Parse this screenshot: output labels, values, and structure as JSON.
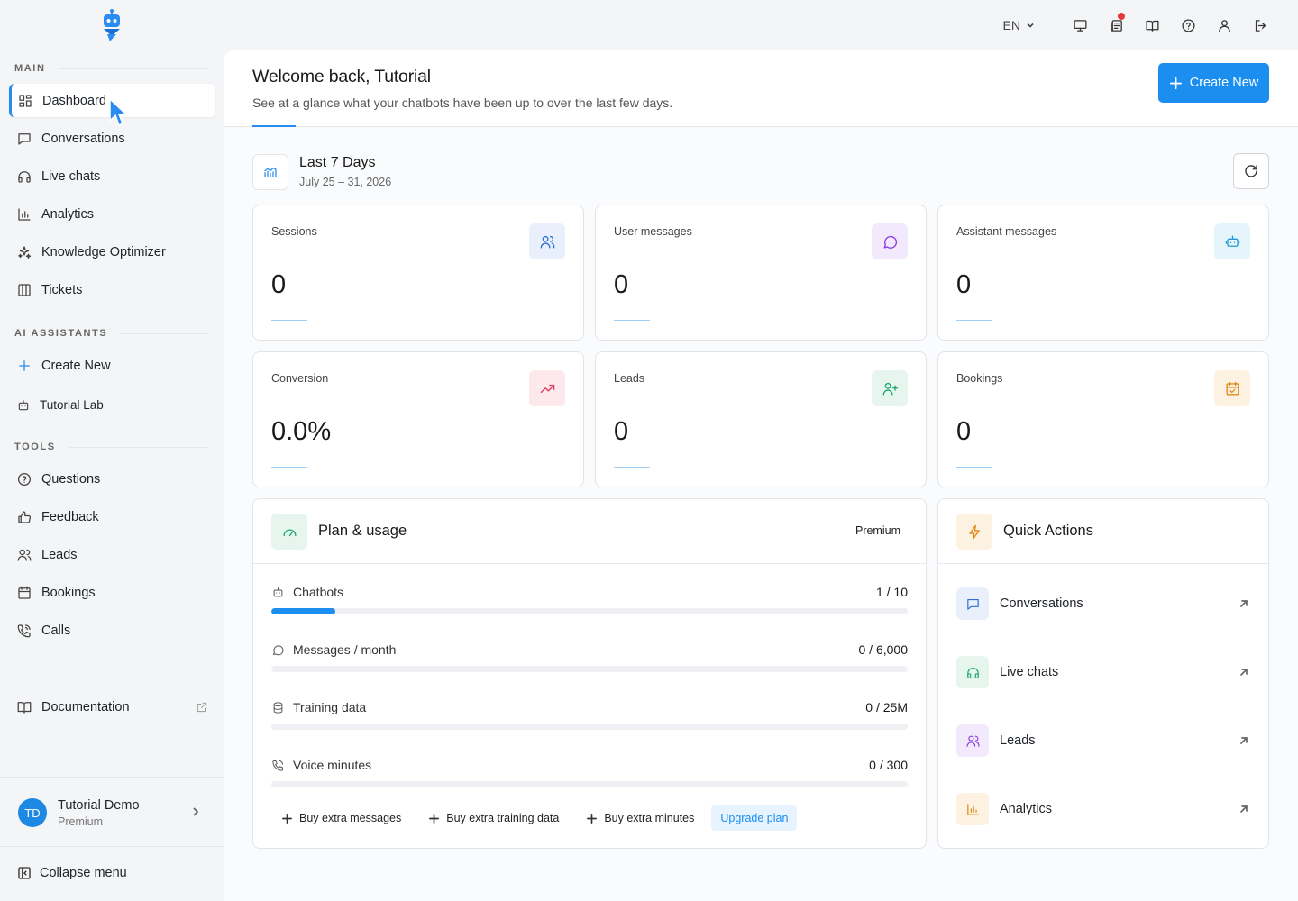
{
  "topbar": {
    "language": "EN"
  },
  "sidebar": {
    "main_label": "MAIN",
    "main_items": [
      "Dashboard",
      "Conversations",
      "Live chats",
      "Analytics",
      "Knowledge Optimizer",
      "Tickets"
    ],
    "assistants_label": "AI ASSISTANTS",
    "assistants_items": [
      "Create New",
      "Tutorial Lab"
    ],
    "tools_label": "TOOLS",
    "tools_items": [
      "Questions",
      "Feedback",
      "Leads",
      "Bookings",
      "Calls"
    ],
    "documentation": "Documentation",
    "user": {
      "initials": "TD",
      "name": "Tutorial Demo",
      "plan": "Premium"
    },
    "collapse": "Collapse menu"
  },
  "header": {
    "title": "Welcome back, Tutorial",
    "subtitle": "See at a glance what your chatbots have been up to over the last few days.",
    "create_button": "Create New"
  },
  "period": {
    "title": "Last 7 Days",
    "range": "July 25 – 31, 2026"
  },
  "stats": [
    {
      "label": "Sessions",
      "value": "0"
    },
    {
      "label": "User messages",
      "value": "0"
    },
    {
      "label": "Assistant messages",
      "value": "0"
    },
    {
      "label": "Conversion",
      "value": "0.0%"
    },
    {
      "label": "Leads",
      "value": "0"
    },
    {
      "label": "Bookings",
      "value": "0"
    }
  ],
  "plan": {
    "title": "Plan & usage",
    "badge": "Premium",
    "rows": [
      {
        "label": "Chatbots",
        "value": "1 / 10",
        "fraction": 0.1
      },
      {
        "label": "Messages / month",
        "value": "0 / 6,000",
        "fraction": 0
      },
      {
        "label": "Training data",
        "value": "0 / 25M",
        "fraction": 0
      },
      {
        "label": "Voice minutes",
        "value": "0 / 300",
        "fraction": 0
      }
    ],
    "actions": [
      "Buy extra messages",
      "Buy extra training data",
      "Buy extra minutes"
    ],
    "upgrade": "Upgrade plan"
  },
  "quick_actions": {
    "title": "Quick Actions",
    "items": [
      "Conversations",
      "Live chats",
      "Leads",
      "Analytics"
    ]
  },
  "colors": {
    "accent": "#1b8ef0",
    "sessions": "#2f6fd6",
    "user_messages": "#8a3ee0",
    "assistant_messages": "#1f9ad6",
    "conversion": "#e03a5b",
    "leads": "#1fa870",
    "bookings": "#e08a1a"
  }
}
